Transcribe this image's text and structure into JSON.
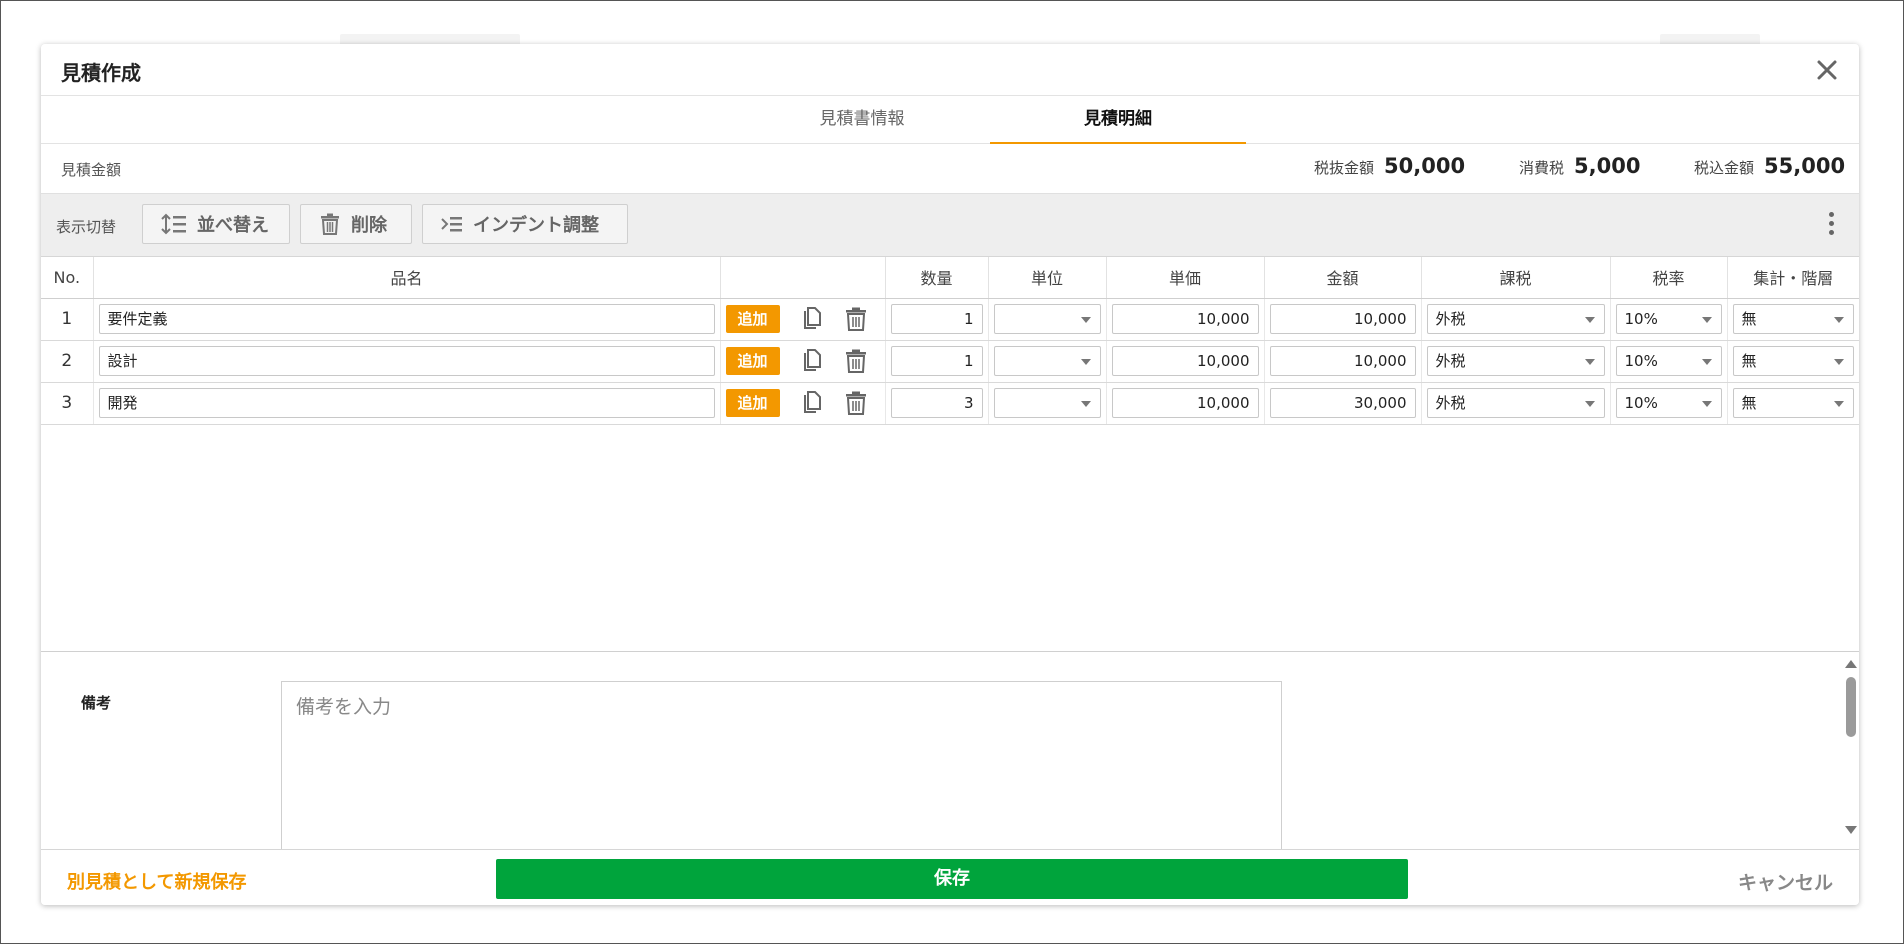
{
  "modal": {
    "title": "見積作成"
  },
  "tabs": [
    {
      "label": "見積書情報",
      "active": false
    },
    {
      "label": "見積明細",
      "active": true
    }
  ],
  "summary": {
    "label": "見積金額",
    "subtotal_label": "税抜金額",
    "subtotal_value": "50,000",
    "tax_label": "消費税",
    "tax_value": "5,000",
    "total_label": "税込金額",
    "total_value": "55,000"
  },
  "toolbar": {
    "view_label": "表示切替",
    "sort_label": "並べ替え",
    "delete_label": "削除",
    "indent_label": "インデント調整"
  },
  "table": {
    "headers": [
      "No.",
      "品名",
      "",
      "数量",
      "単位",
      "単価",
      "金額",
      "課税",
      "税率",
      "集計・階層"
    ],
    "add_label": "追加",
    "rows": [
      {
        "no": "1",
        "name": "要件定義",
        "qty": "1",
        "unit": "",
        "price": "10,000",
        "amount": "10,000",
        "taxation": "外税",
        "rate": "10%",
        "group": "無"
      },
      {
        "no": "2",
        "name": "設計",
        "qty": "1",
        "unit": "",
        "price": "10,000",
        "amount": "10,000",
        "taxation": "外税",
        "rate": "10%",
        "group": "無"
      },
      {
        "no": "3",
        "name": "開発",
        "qty": "3",
        "unit": "",
        "price": "10,000",
        "amount": "30,000",
        "taxation": "外税",
        "rate": "10%",
        "group": "無"
      }
    ]
  },
  "notes": {
    "label": "備考",
    "placeholder": "備考を入力"
  },
  "footer": {
    "save_as_label": "別見積として新規保存",
    "save_label": "保存",
    "cancel_label": "キャンセル"
  },
  "colors": {
    "accent": "#f39800",
    "save": "#00a43c"
  },
  "icons": [
    "close-icon",
    "sort-icon",
    "trash-icon",
    "indent-icon",
    "kebab-icon",
    "copy-icon"
  ]
}
